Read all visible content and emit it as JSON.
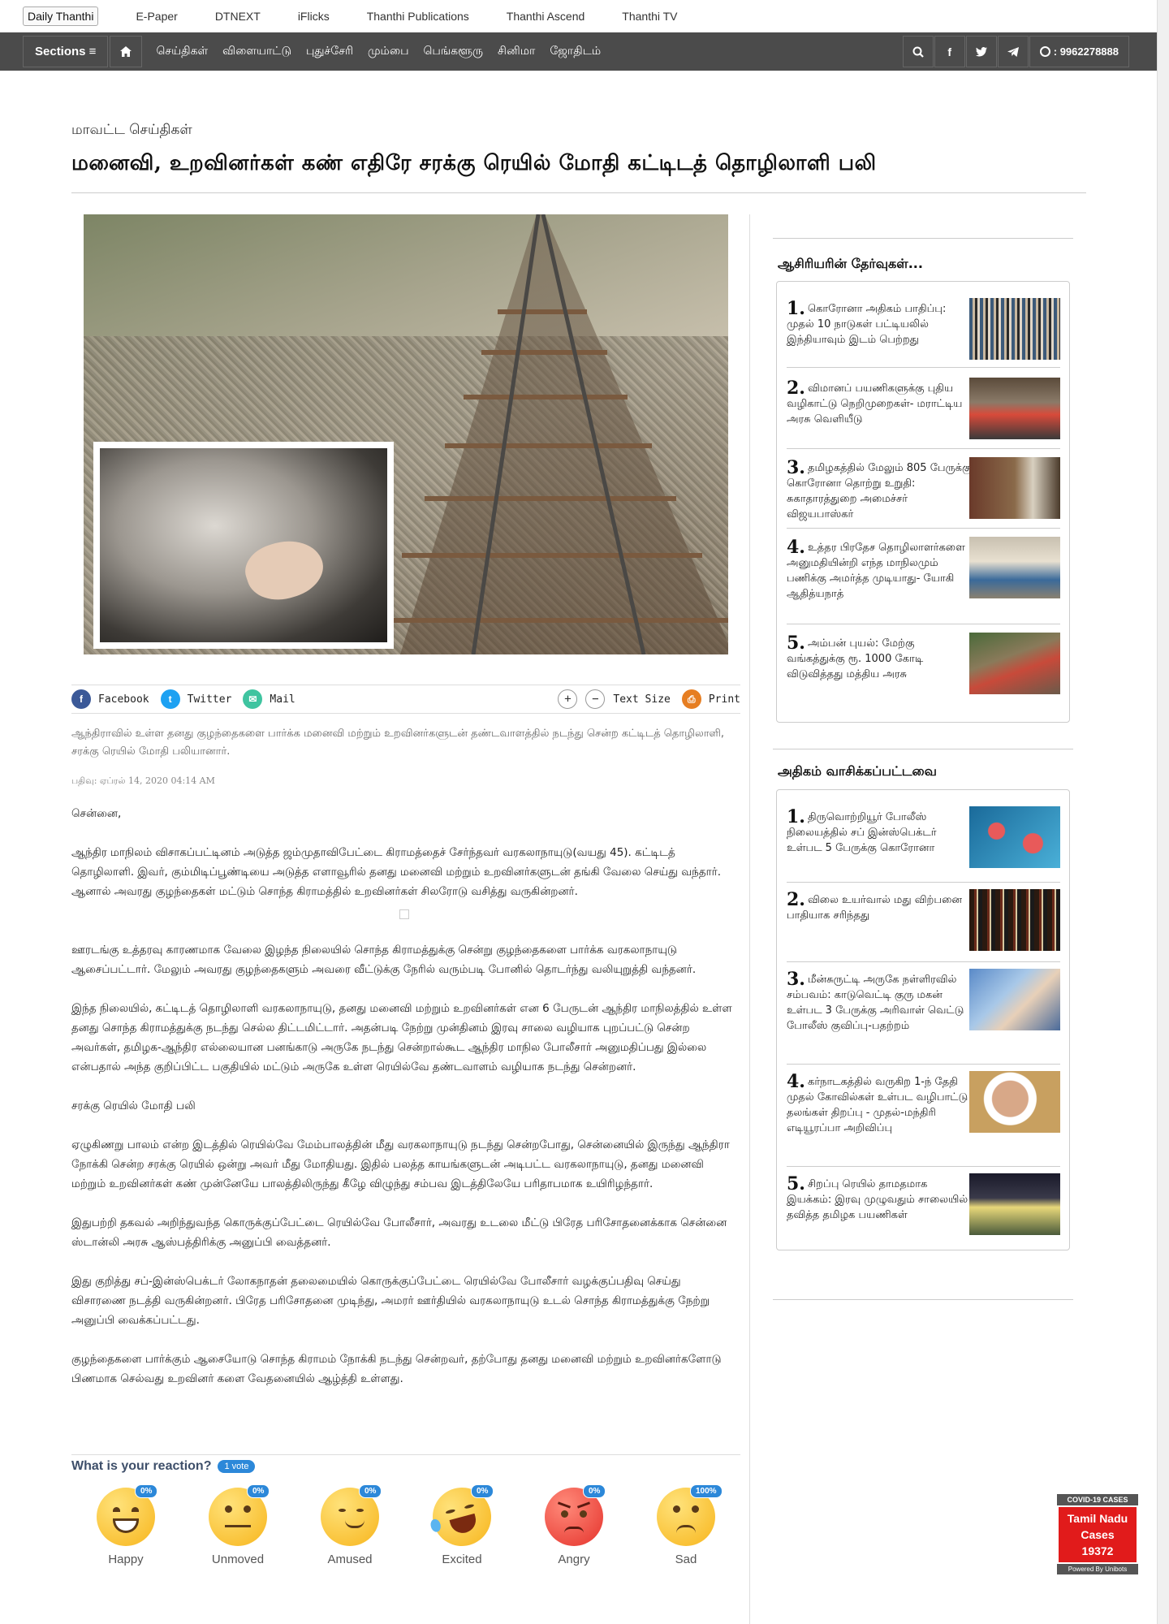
{
  "topbar": {
    "brand": "Daily Thanthi",
    "links": [
      "E-Paper",
      "DTNEXT",
      "iFlicks",
      "Thanthi Publications",
      "Thanthi Ascend",
      "Thanthi TV"
    ]
  },
  "nav": {
    "sections_label": "Sections ≡",
    "home_icon": "home-icon",
    "items": [
      "செய்திகள்",
      "விளையாட்டு",
      "புதுச்சேரி",
      "மும்பை",
      "பெங்களூரு",
      "சினிமா",
      "ஜோதிடம்"
    ],
    "phone": ":  9962278888",
    "bg_color": "#4b4b4b"
  },
  "article": {
    "category": "மாவட்ட செய்திகள்",
    "headline": "மனைவி, உறவினர்கள் கண் எதிரே சரக்கு ரெயில் மோதி கட்டிடத் தொழிலாளி பலி",
    "share": {
      "facebook": "Facebook",
      "twitter": "Twitter",
      "mail": "Mail",
      "plus": "+",
      "minus": "−",
      "text_size": "Text Size",
      "print": "Print"
    },
    "summary": "ஆந்திராவில் உள்ள தனது குழந்தைகளை பார்க்க மனைவி மற்றும் உறவினர்களுடன் தண்டவாளத்தில் நடந்து சென்ற கட்டிடத் தொழிலாளி, சரக்கு ரெயில் மோதி பலியானார்.",
    "dateline": "பதிவு: ஏப்ரல் 14,   2020 04:14 AM",
    "paragraphs": [
      "சென்னை,",
      "ஆந்திர மாநிலம் விசாகப்பட்டினம் அடுத்த ஜம்முதாவிபேட்டை கிராமத்தைச் சேர்ந்தவர் வரகலாநாயுடு(வயது 45). கட்டிடத் தொழிலாளி. இவர், கும்மிடிப்பூண்டியை அடுத்த எளாவூரில் தனது மனைவி மற்றும் உறவினர்களுடன் தங்கி வேலை செய்து வந்தார். ஆனால் அவரது குழந்தைகள் மட்டும் சொந்த கிராமத்தில் உறவினர்கள் சிலரோடு வசித்து வருகின்றனர்.",
      "ஊரடங்கு உத்தரவு காரணமாக வேலை இழந்த நிலையில் சொந்த கிராமத்துக்கு சென்று குழந்தைகளை பார்க்க வரகலாநாயுடு ஆசைப்பட்டார். மேலும் அவரது குழந்தைகளும் அவரை வீட்டுக்கு நேரில் வரும்படி போனில் தொடர்ந்து வலியுறுத்தி வந்தனர்.",
      "இந்த நிலையில், கட்டிடத் தொழிலாளி வரகலாநாயுடு, தனது மனைவி மற்றும் உறவினர்கள் என 6 பேருடன் ஆந்திர மாநிலத்தில் உள்ள தனது சொந்த கிராமத்துக்கு நடந்து செல்ல திட்டமிட்டார். அதன்படி நேற்று முன்தினம் இரவு சாலை வழியாக புறப்பட்டு சென்ற அவர்கள், தமிழக-ஆந்திர எல்லையான பனங்காடு அருகே நடந்து சென்றால்கூட ஆந்திர மாநில போலீசார் அனுமதிப்பது இல்லை என்பதால் அந்த குறிப்பிட்ட பகுதியில் மட்டும் அருகே உள்ள ரெயில்வே தண்டவாளம் வழியாக நடந்து சென்றனர்.",
      "சரக்கு ரெயில் மோதி பலி",
      "ஏழுகிணறு பாலம் என்ற இடத்தில் ரெயில்வே மேம்பாலத்தின் மீது வரகலாநாயுடு நடந்து சென்றபோது, சென்னையில் இருந்து ஆந்திரா நோக்கி சென்ற சரக்கு ரெயில் ஒன்று அவர் மீது மோதியது. இதில் பலத்த காயங்களுடன் அடிபட்ட வரகலாநாயுடு, தனது மனைவி மற்றும் உறவினர்கள் கண் முன்னேயே பாலத்திலிருந்து கீழே விழுந்து சம்பவ இடத்திலேயே பரிதாபமாக உயிரிழந்தார்.",
      "இதுபற்றி தகவல் அறிந்துவந்த கொருக்குப்பேட்டை ரெயில்வே போலீசார், அவரது உடலை மீட்டு பிரேத பரிசோதனைக்காக சென்னை ஸ்டான்லி அரசு ஆஸ்பத்திரிக்கு அனுப்பி வைத்தனர்.",
      "இது குறித்து சப்-இன்ஸ்பெக்டர் லோகநாதன் தலைமையில் கொருக்குப்பேட்டை ரெயில்வே போலீசார் வழக்குப்பதிவு செய்து விசாரணை நடத்தி வருகின்றனர். பிரேத பரிசோதனை முடிந்து, அமரர் ஊர்தியில் வரகலாநாயுடு உடல் சொந்த கிராமத்துக்கு நேற்று அனுப்பி வைக்கப்பட்டது.",
      "குழந்தைகளை பார்க்கும் ஆசையோடு சொந்த கிராமம் நோக்கி நடந்து சென்றவர், தற்போது தனது மனைவி மற்றும் உறவினர்களோடு பிணமாக செல்வது உறவினர் களை வேதனையில் ஆழ்த்தி உள்ளது."
    ]
  },
  "reactions": {
    "title": "What is your reaction?",
    "votes": "1 vote",
    "items": [
      {
        "label": "Happy",
        "pct": "0%"
      },
      {
        "label": "Unmoved",
        "pct": "0%"
      },
      {
        "label": "Amused",
        "pct": "0%"
      },
      {
        "label": "Excited",
        "pct": "0%"
      },
      {
        "label": "Angry",
        "pct": "0%"
      },
      {
        "label": "Sad",
        "pct": "100%"
      }
    ]
  },
  "sidebar": {
    "editors_title": "ஆசிரியரின் தேர்வுகள்...",
    "editors": [
      {
        "num": "1.",
        "text": "கொரோனா அதிகம் பாதிப்பு: முதல் 10 நாடுகள் பட்டியலில் இந்தியாவும் இடம் பெற்றது"
      },
      {
        "num": "2.",
        "text": "விமானப் பயணிகளுக்கு புதிய வழிகாட்டு நெறிமுறைகள்- மராட்டிய அரசு வெளியீடு"
      },
      {
        "num": "3.",
        "text": "தமிழகத்தில் மேலும் 805 பேருக்கு கொரோனா தொற்று உறுதி: சுகாதாரத்துறை அமைச்சர் விஜயபாஸ்கர்"
      },
      {
        "num": "4.",
        "text": "உத்தர பிரதேச தொழிலாளர்களை அனுமதியின்றி எந்த மாநிலமும் பணிக்கு அமர்த்த முடியாது- யோகி ஆதித்யநாத்"
      },
      {
        "num": "5.",
        "text": "அம்பன் புயல்: மேற்கு வங்கத்துக்கு ரூ. 1000 கோடி விடுவித்தது மத்திய அரசு"
      }
    ],
    "popular_title": "அதிகம் வாசிக்கப்பட்டவை",
    "popular": [
      {
        "num": "1.",
        "text": "திருவொற்றியூர் போலீஸ் நிலையத்தில் சப் இன்ஸ்பெக்டர் உள்பட 5 பேருக்கு கொரோனா"
      },
      {
        "num": "2.",
        "text": "விலை உயர்வால் மது விற்பனை பாதியாக சரிந்தது"
      },
      {
        "num": "3.",
        "text": "மீன்சுருட்டி அருகே நள்ளிரவில் சம்பவம்: காடுவெட்டி குரு மகன் உள்பட 3 பேருக்கு அரிவாள் வெட்டு போலீஸ் குவிப்பு-பதற்றம்"
      },
      {
        "num": "4.",
        "text": "கர்நாடகத்தில் வருகிற 1-ந் தேதி முதல் கோவில்கள் உள்பட வழிபாட்டு தலங்கள் திறப்பு - முதல்-மந்திரி எடியூரப்பா அறிவிப்பு"
      },
      {
        "num": "5.",
        "text": "சிறப்பு ரெயில் தாமதமாக இயக்கம்: இரவு முழுவதும் சாலையில் தவித்த தமிழக பயணிகள்"
      }
    ]
  },
  "covid": {
    "header": "COVID-19 CASES",
    "region": "Tamil Nadu",
    "label": "Cases",
    "count": "19372",
    "footer": "Powered By Unibots"
  }
}
